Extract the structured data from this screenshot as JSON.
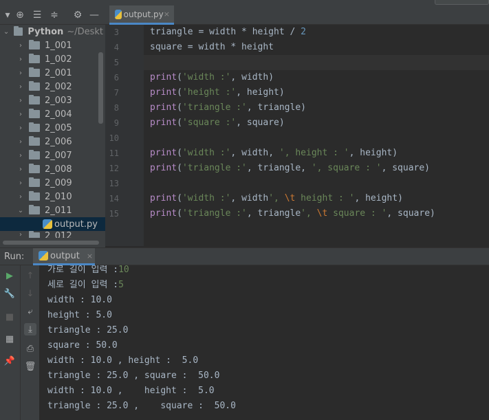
{
  "editor_tab": {
    "filename": "output.py",
    "close": "×"
  },
  "project": {
    "root_name": "Python",
    "root_path": "~/Deskt",
    "folders": [
      "1_001",
      "1_002",
      "2_001",
      "2_002",
      "2_003",
      "2_004",
      "2_005",
      "2_006",
      "2_007",
      "2_008",
      "2_009",
      "2_010",
      "2_011"
    ],
    "open_file": "output.py",
    "cut_folder": "2_012"
  },
  "code_lines": [
    {
      "no": "3",
      "segments": [
        [
          "p",
          "triangle = width * height / "
        ],
        [
          "num",
          "2"
        ]
      ]
    },
    {
      "no": "4",
      "segments": [
        [
          "p",
          "square = width * height"
        ]
      ]
    },
    {
      "no": "5",
      "segments": []
    },
    {
      "no": "6",
      "segments": [
        [
          "kw",
          "print"
        ],
        [
          "p",
          "("
        ],
        [
          "str",
          "'width :'"
        ],
        [
          "p",
          ", width)"
        ]
      ]
    },
    {
      "no": "7",
      "segments": [
        [
          "kw",
          "print"
        ],
        [
          "p",
          "("
        ],
        [
          "str",
          "'height :'"
        ],
        [
          "p",
          ", height)"
        ]
      ]
    },
    {
      "no": "8",
      "segments": [
        [
          "kw",
          "print"
        ],
        [
          "p",
          "("
        ],
        [
          "str",
          "'triangle :'"
        ],
        [
          "p",
          ", triangle)"
        ]
      ]
    },
    {
      "no": "9",
      "segments": [
        [
          "kw",
          "print"
        ],
        [
          "p",
          "("
        ],
        [
          "str",
          "'square :'"
        ],
        [
          "p",
          ", square)"
        ]
      ]
    },
    {
      "no": "10",
      "segments": []
    },
    {
      "no": "11",
      "segments": [
        [
          "kw",
          "print"
        ],
        [
          "p",
          "("
        ],
        [
          "str",
          "'width :'"
        ],
        [
          "p",
          ", width, "
        ],
        [
          "str",
          "', height : '"
        ],
        [
          "p",
          ", height)"
        ]
      ]
    },
    {
      "no": "12",
      "segments": [
        [
          "kw",
          "print"
        ],
        [
          "p",
          "("
        ],
        [
          "str",
          "'triangle :'"
        ],
        [
          "p",
          ", triangle, "
        ],
        [
          "str",
          "', square : '"
        ],
        [
          "p",
          ", square)"
        ]
      ]
    },
    {
      "no": "13",
      "segments": []
    },
    {
      "no": "14",
      "segments": [
        [
          "kw",
          "print"
        ],
        [
          "p",
          "("
        ],
        [
          "str",
          "'width :'"
        ],
        [
          "p",
          ", width"
        ],
        [
          "str",
          "', "
        ],
        [
          "esc",
          "\\t"
        ],
        [
          "str",
          " height : '"
        ],
        [
          "p",
          ", height)"
        ]
      ]
    },
    {
      "no": "15",
      "segments": [
        [
          "kw",
          "print"
        ],
        [
          "p",
          "("
        ],
        [
          "str",
          "'triangle :'"
        ],
        [
          "p",
          ", triangle"
        ],
        [
          "str",
          "', "
        ],
        [
          "esc",
          "\\t"
        ],
        [
          "str",
          " square : '"
        ],
        [
          "p",
          ", square)"
        ]
      ]
    }
  ],
  "run": {
    "label": "Run:",
    "tab": "output",
    "close": "×",
    "console": [
      {
        "text": "가로 길이 입력 :",
        "input": "10"
      },
      {
        "text": "세로 길이 입력 :",
        "input": "5"
      },
      {
        "text": "width : 10.0"
      },
      {
        "text": "height : 5.0"
      },
      {
        "text": "triangle : 25.0"
      },
      {
        "text": "square : 50.0"
      },
      {
        "text": "width : 10.0 , height :  5.0"
      },
      {
        "text": "triangle : 25.0 , square :  50.0"
      },
      {
        "text": "width : 10.0 ,    height :  5.0"
      },
      {
        "text": "triangle : 25.0 ,    square :  50.0"
      }
    ]
  },
  "colors": {
    "keyword": "#b88cc9",
    "string": "#6a8759",
    "number": "#6897bb",
    "escape": "#cc7832",
    "accent": "#4a88c7"
  }
}
